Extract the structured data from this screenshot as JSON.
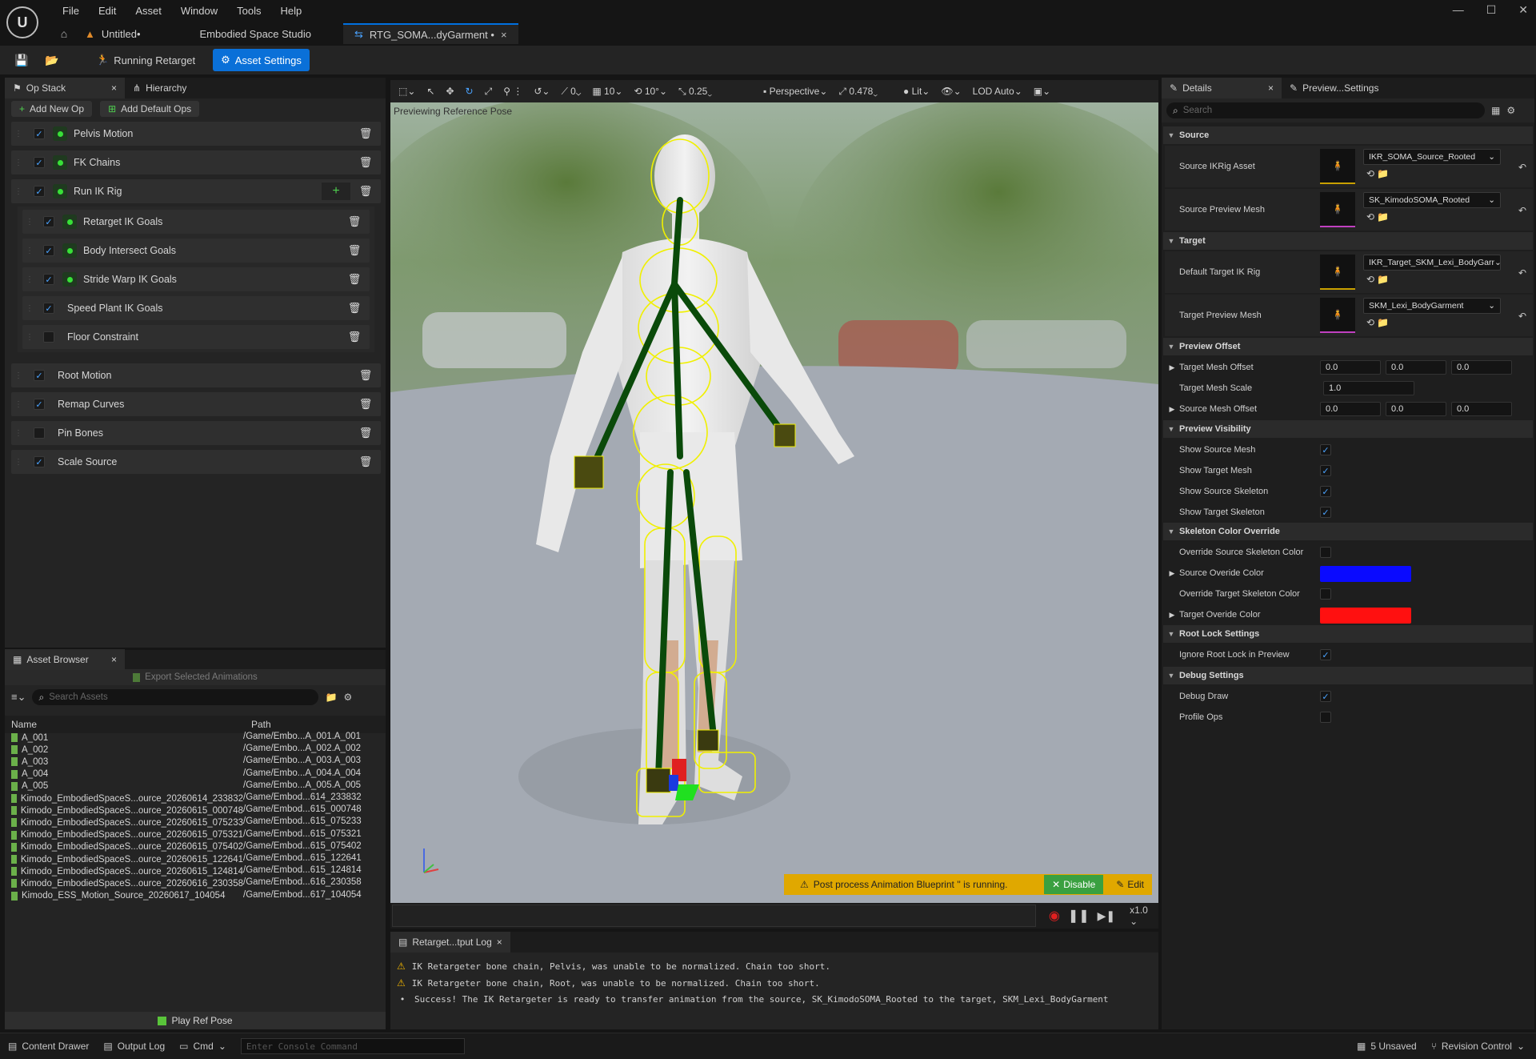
{
  "menu": [
    "File",
    "Edit",
    "Asset",
    "Window",
    "Tools",
    "Help"
  ],
  "doc_tabs": {
    "untitled": "Untitled•",
    "studio": "Embodied Space Studio",
    "active": "RTG_SOMA...dyGarment •"
  },
  "toolbar": {
    "running_retarget": "Running Retarget",
    "asset_settings": "Asset Settings"
  },
  "op_stack": {
    "tab_label": "Op Stack",
    "hierarchy_tab": "Hierarchy",
    "add_new_op": "Add New Op",
    "add_default_ops": "Add Default Ops",
    "ops": [
      {
        "label": "Pelvis Motion",
        "checked": true
      },
      {
        "label": "FK Chains",
        "checked": true
      },
      {
        "label": "Run IK Rig",
        "checked": true
      },
      {
        "label": "Retarget IK Goals",
        "checked": true
      },
      {
        "label": "Body Intersect Goals",
        "checked": true
      },
      {
        "label": "Stride Warp IK Goals",
        "checked": true
      },
      {
        "label": "Speed Plant IK Goals",
        "checked": true
      },
      {
        "label": "Floor Constraint",
        "checked": false
      },
      {
        "label": "Root Motion",
        "checked": true
      },
      {
        "label": "Remap Curves",
        "checked": true
      },
      {
        "label": "Pin Bones",
        "checked": false
      },
      {
        "label": "Scale Source",
        "checked": true
      }
    ]
  },
  "asset_browser": {
    "tab_label": "Asset Browser",
    "export_label": "Export Selected Animations",
    "search_placeholder": "Search Assets",
    "col_name": "Name",
    "col_path": "Path",
    "rows": [
      {
        "name": "A_001",
        "path": "/Game/Embo...A_001.A_001"
      },
      {
        "name": "A_002",
        "path": "/Game/Embo...A_002.A_002"
      },
      {
        "name": "A_003",
        "path": "/Game/Embo...A_003.A_003"
      },
      {
        "name": "A_004",
        "path": "/Game/Embo...A_004.A_004"
      },
      {
        "name": "A_005",
        "path": "/Game/Embo...A_005.A_005"
      },
      {
        "name": "Kimodo_EmbodiedSpaceS...ource_20260614_233832",
        "path": "/Game/Embod...614_233832"
      },
      {
        "name": "Kimodo_EmbodiedSpaceS...ource_20260615_000748",
        "path": "/Game/Embod...615_000748"
      },
      {
        "name": "Kimodo_EmbodiedSpaceS...ource_20260615_075233",
        "path": "/Game/Embod...615_075233"
      },
      {
        "name": "Kimodo_EmbodiedSpaceS...ource_20260615_075321",
        "path": "/Game/Embod...615_075321"
      },
      {
        "name": "Kimodo_EmbodiedSpaceS...ource_20260615_075402",
        "path": "/Game/Embod...615_075402"
      },
      {
        "name": "Kimodo_EmbodiedSpaceS...ource_20260615_122641",
        "path": "/Game/Embod...615_122641"
      },
      {
        "name": "Kimodo_EmbodiedSpaceS...ource_20260615_124814",
        "path": "/Game/Embod...615_124814"
      },
      {
        "name": "Kimodo_EmbodiedSpaceS...ource_20260616_230358",
        "path": "/Game/Embod...616_230358"
      },
      {
        "name": "Kimodo_ESS_Motion_Source_20260617_104054",
        "path": "/Game/Embod...617_104054"
      }
    ],
    "play_ref_pose": "Play Ref Pose"
  },
  "viewport": {
    "toolbar": {
      "angle": "0",
      "grid": "10",
      "rot": "10°",
      "scale": "0.25",
      "perspective": "Perspective",
      "fov": "0.478",
      "lit": "Lit",
      "lod": "LOD Auto"
    },
    "overlay_label": "Previewing Reference Pose",
    "notice": "Post process Animation Blueprint '' is running.",
    "disable_label": "Disable",
    "edit_label": "Edit",
    "speed": "x1.0"
  },
  "log": {
    "tab_label": "Retarget...tput Log",
    "lines": [
      {
        "level": "warning",
        "text": "IK Retargeter bone chain, Pelvis, was unable to be normalized. Chain too short."
      },
      {
        "level": "warning",
        "text": "IK Retargeter bone chain, Root, was unable to be normalized. Chain too short."
      },
      {
        "level": "info",
        "text": "Success! The IK Retargeter is ready to transfer animation from the source, SK_KimodoSOMA_Rooted to the target, SKM_Lexi_BodyGarment"
      }
    ]
  },
  "details": {
    "tab_label": "Details",
    "preview_tab": "Preview...Settings",
    "search_placeholder": "Search",
    "sections": {
      "source": "Source",
      "target": "Target",
      "preview_offset": "Preview Offset",
      "preview_visibility": "Preview Visibility",
      "skeleton_color": "Skeleton Color Override",
      "root_lock": "Root Lock Settings",
      "debug": "Debug Settings"
    },
    "source_ikrig_label": "Source IKRig Asset",
    "source_ikrig_value": "IKR_SOMA_Source_Rooted",
    "source_mesh_label": "Source Preview Mesh",
    "source_mesh_value": "SK_KimodoSOMA_Rooted",
    "target_ikrig_label": "Default Target IK Rig",
    "target_ikrig_value": "IKR_Target_SKM_Lexi_BodyGarr",
    "target_mesh_label": "Target Preview Mesh",
    "target_mesh_value": "SKM_Lexi_BodyGarment",
    "target_mesh_offset_label": "Target Mesh Offset",
    "target_mesh_offset": [
      "0.0",
      "0.0",
      "0.0"
    ],
    "target_mesh_scale_label": "Target Mesh Scale",
    "target_mesh_scale": "1.0",
    "source_mesh_offset_label": "Source Mesh Offset",
    "source_mesh_offset": [
      "0.0",
      "0.0",
      "0.0"
    ],
    "show_source_mesh": "Show Source Mesh",
    "show_target_mesh": "Show Target Mesh",
    "show_source_skeleton": "Show Source Skeleton",
    "show_target_skeleton": "Show Target Skeleton",
    "override_source_color": "Override Source Skeleton Color",
    "source_override_color": "Source Overide Color",
    "source_color_hex": "#0a0aff",
    "override_target_color": "Override Target Skeleton Color",
    "target_override_color": "Target Overide Color",
    "target_color_hex": "#ff1010",
    "ignore_root_lock": "Ignore Root Lock in Preview",
    "debug_draw": "Debug Draw",
    "profile_ops": "Profile Ops"
  },
  "statusbar": {
    "content_drawer": "Content Drawer",
    "output_log": "Output Log",
    "cmd": "Cmd",
    "console_placeholder": "Enter Console Command",
    "unsaved": "5 Unsaved",
    "revision_control": "Revision Control"
  }
}
